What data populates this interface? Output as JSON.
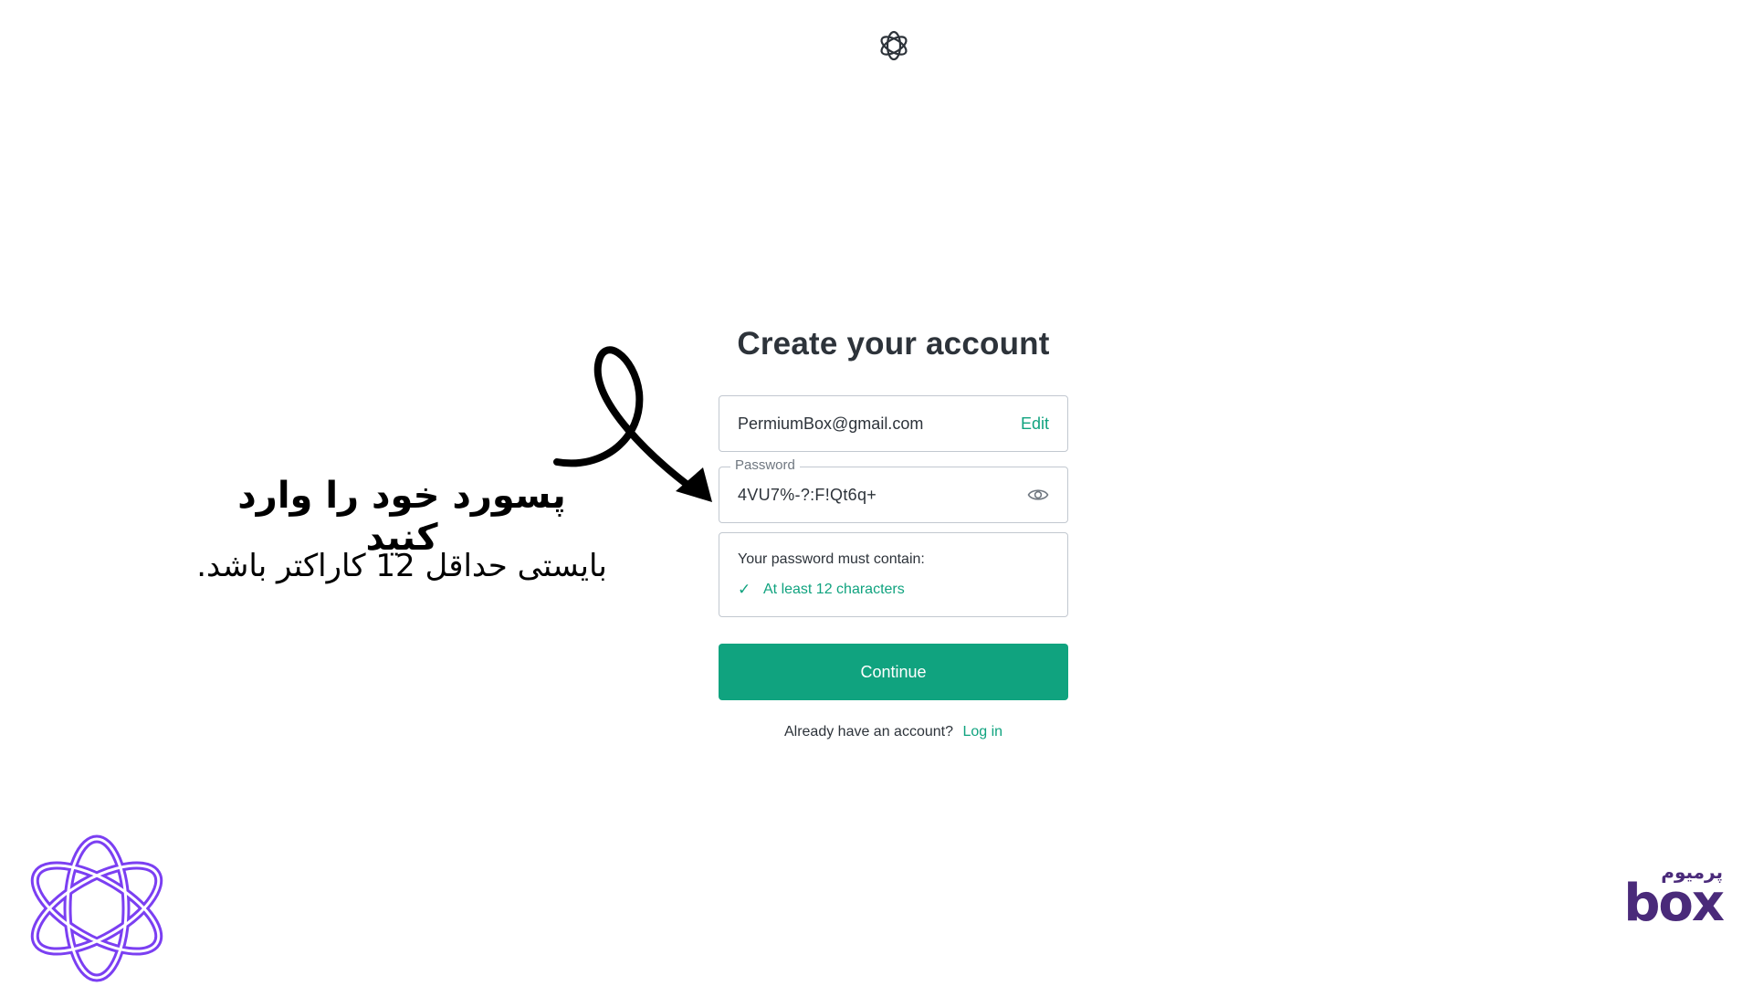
{
  "form": {
    "title": "Create your account",
    "email_value": "PermiumBox@gmail.com",
    "edit_label": "Edit",
    "password_label": "Password",
    "password_value": "4VU7%-?:F!Qt6q+",
    "requirements_title": "Your password must contain:",
    "requirement_check": "✓",
    "requirement_item": "At least 12 characters",
    "continue_label": "Continue",
    "login_prompt": "Already have an account?",
    "login_link": "Log in"
  },
  "annotation": {
    "title": "پسورد خود را وارد کنید",
    "subtitle": "بایستی حداقل 12 کاراکتر باشد."
  },
  "brand": {
    "small": "پرمیوم",
    "big": "box"
  },
  "colors": {
    "accent": "#10a37f",
    "border": "#c2c8d0",
    "brand_purple": "#7b3ff2",
    "brand_dark": "#4a2a7a"
  },
  "icons": {
    "top_logo": "openai-logo-icon",
    "eye": "eye-icon",
    "arrow": "curved-arrow-icon",
    "corner_logo": "openai-logo-purple-icon"
  }
}
